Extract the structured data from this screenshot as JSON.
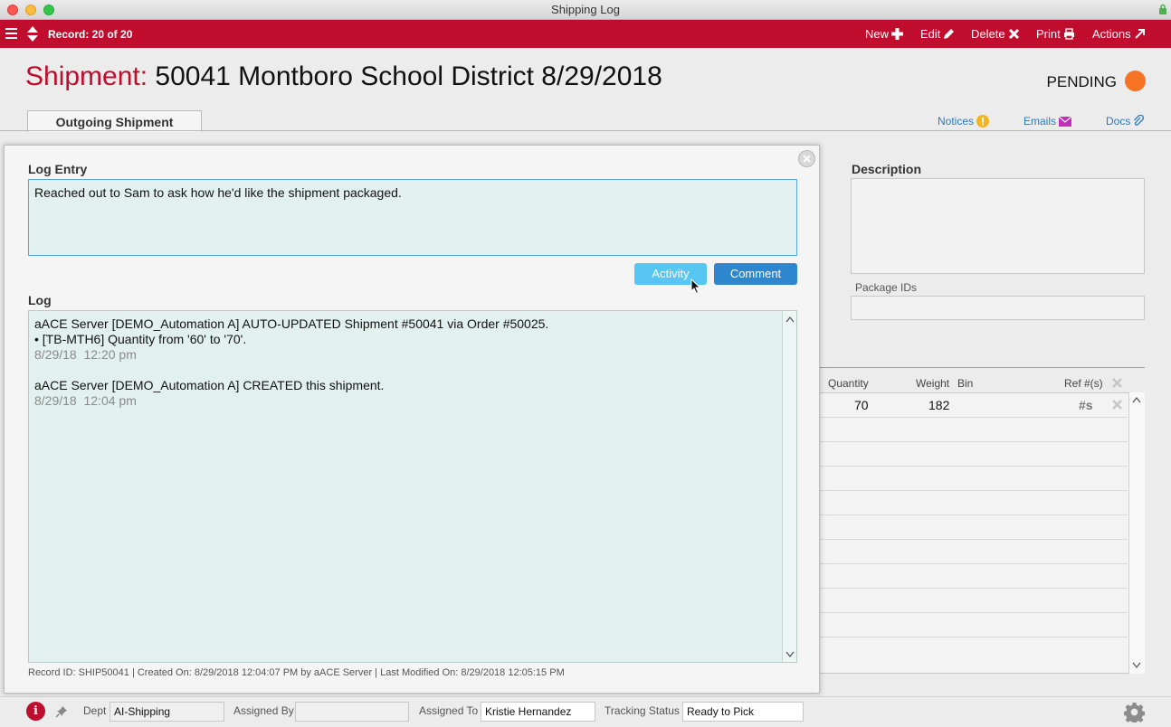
{
  "window": {
    "title": "Shipping Log"
  },
  "toolbar": {
    "record": "Record: 20 of 20",
    "new_label": "New",
    "edit_label": "Edit",
    "delete_label": "Delete",
    "print_label": "Print",
    "actions_label": "Actions"
  },
  "header": {
    "title_label": "Shipment:",
    "title_value": "50041 Montboro School District  8/29/2018",
    "status": "PENDING",
    "tab": "Outgoing Shipment",
    "links": {
      "notices": "Notices",
      "emails": "Emails",
      "docs": "Docs"
    }
  },
  "right_panel": {
    "description_label": "Description",
    "package_ids_label": "Package IDs",
    "grid_headers": {
      "quantity": "Quantity",
      "weight": "Weight",
      "bin": "Bin",
      "ref": "Ref #(s)"
    },
    "row": {
      "quantity": "70",
      "weight": "182",
      "ref_icon": "#s"
    }
  },
  "modal": {
    "log_entry_label": "Log Entry",
    "log_entry_value": "Reached out to Sam to ask how he'd like the shipment packaged.",
    "activity_button": "Activity",
    "comment_button": "Comment",
    "log_label": "Log",
    "log_entries": [
      {
        "line1": "aACE Server [DEMO_Automation A] AUTO-UPDATED Shipment #50041 via Order #50025.",
        "line2": "• [TB-MTH6] Quantity from '60' to '70'.",
        "timestamp": "8/29/18  12:20 pm"
      },
      {
        "line1": "aACE Server [DEMO_Automation A] CREATED this shipment.",
        "timestamp": "8/29/18  12:04 pm"
      }
    ],
    "footer": "Record ID: SHIP50041  |  Created On: 8/29/2018 12:04:07 PM by aACE Server  |  Last Modified On: 8/29/2018 12:05:15 PM"
  },
  "bottom": {
    "dept_label": "Dept",
    "dept_value": "AI-Shipping",
    "assigned_by_label": "Assigned By",
    "assigned_by_value": "",
    "assigned_to_label": "Assigned To",
    "assigned_to_value": "Kristie Hernandez",
    "tracking_label": "Tracking Status",
    "tracking_value": "Ready to Pick"
  },
  "colors": {
    "brand": "#c00d2d",
    "status": "#f57322",
    "activity": "#57c6f3",
    "comment": "#2e86cf"
  }
}
